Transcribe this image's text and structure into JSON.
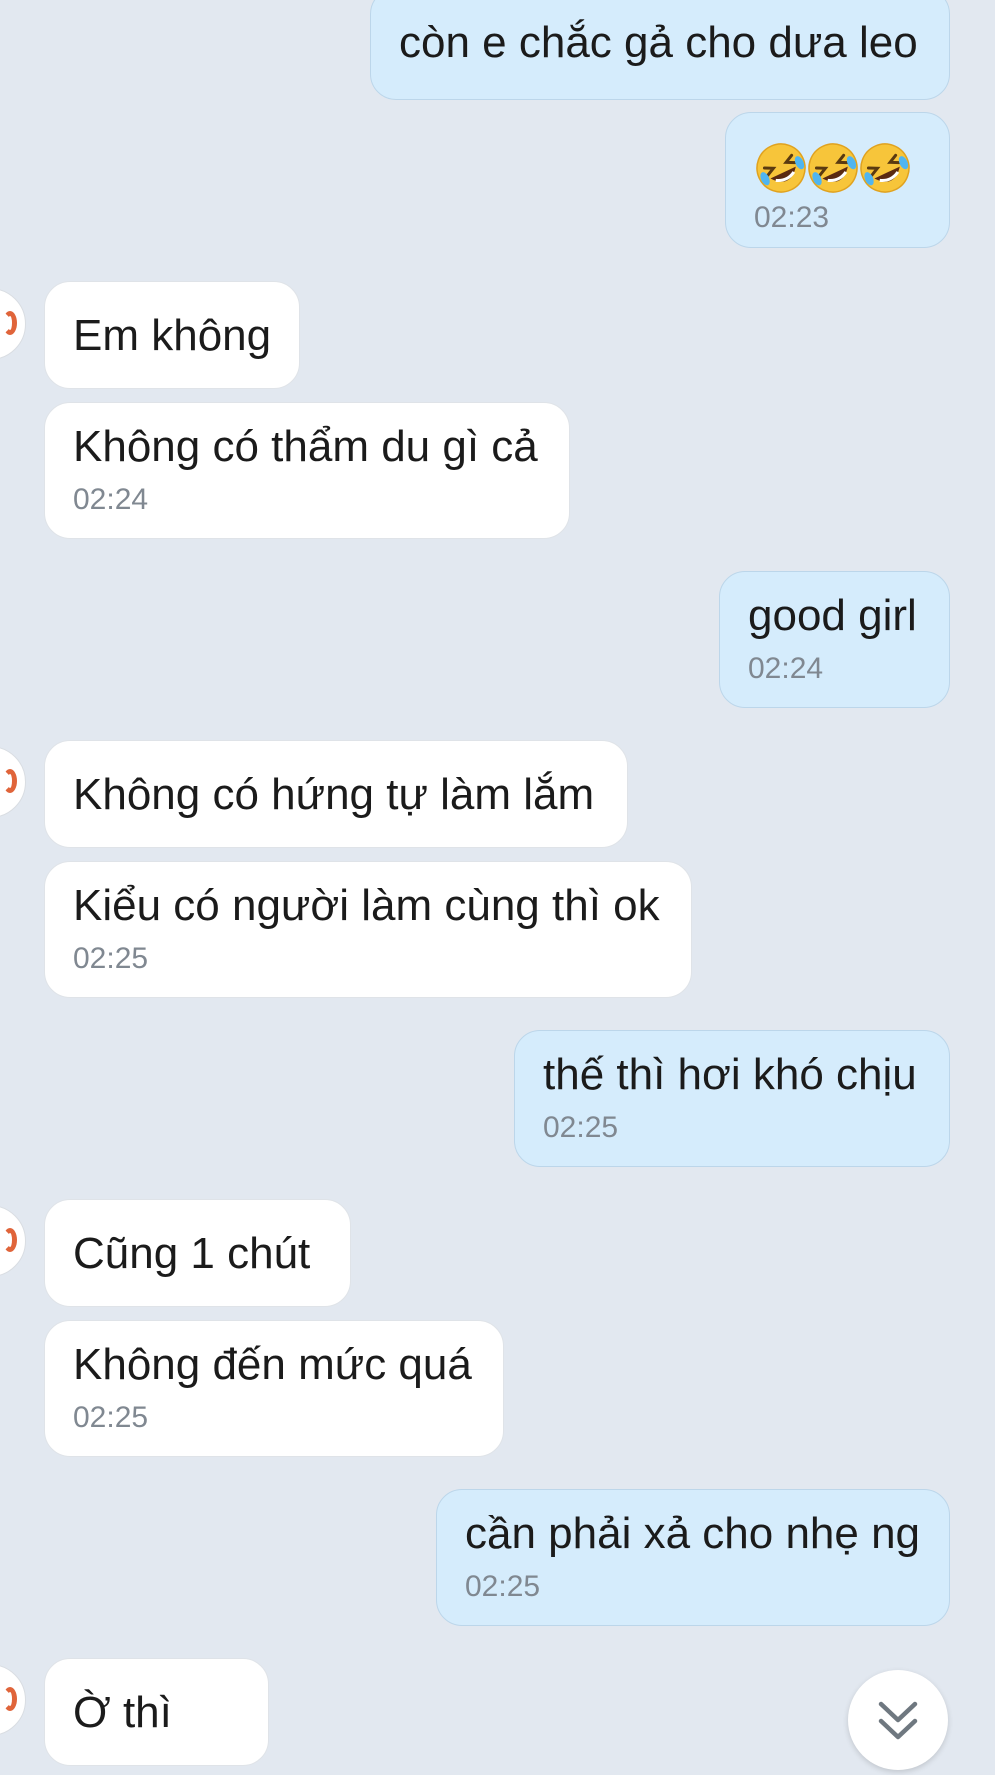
{
  "messages": [
    {
      "id": "m1",
      "sender": "me",
      "text": "còn e chắc gả cho dưa leo",
      "time": ""
    },
    {
      "id": "m2",
      "sender": "me",
      "emoji": [
        "rolling-on-floor-laughing",
        "rolling-on-floor-laughing",
        "rolling-on-floor-laughing"
      ],
      "time": "02:23"
    },
    {
      "id": "m3",
      "sender": "them",
      "text": "Em không",
      "time": ""
    },
    {
      "id": "m4",
      "sender": "them",
      "text": "Không có thẩm du gì cả",
      "time": "02:24"
    },
    {
      "id": "m5",
      "sender": "me",
      "text": "good girl",
      "time": "02:24"
    },
    {
      "id": "m6",
      "sender": "them",
      "text": "Không có hứng tự làm lắm",
      "time": ""
    },
    {
      "id": "m7",
      "sender": "them",
      "text": "Kiểu có người làm cùng thì ok",
      "time": "02:25"
    },
    {
      "id": "m8",
      "sender": "me",
      "text": "thế thì hơi khó chịu",
      "time": "02:25"
    },
    {
      "id": "m9",
      "sender": "them",
      "text": "Cũng 1 chút",
      "time": ""
    },
    {
      "id": "m10",
      "sender": "them",
      "text": "Không đến mức quá",
      "time": "02:25"
    },
    {
      "id": "m11",
      "sender": "me",
      "text": "cần phải xả cho nhẹ ng",
      "time": "02:25"
    },
    {
      "id": "m12",
      "sender": "them",
      "text": "Ờ thì",
      "time": ""
    }
  ],
  "scroll_button": {
    "icon": "double-chevron-down-icon"
  },
  "colors": {
    "background": "#e2e8f0",
    "incoming_bubble": "#ffffff",
    "outgoing_bubble": "#d5ecfc",
    "timestamp": "#808891",
    "avatar_accent": "#e0643a"
  }
}
